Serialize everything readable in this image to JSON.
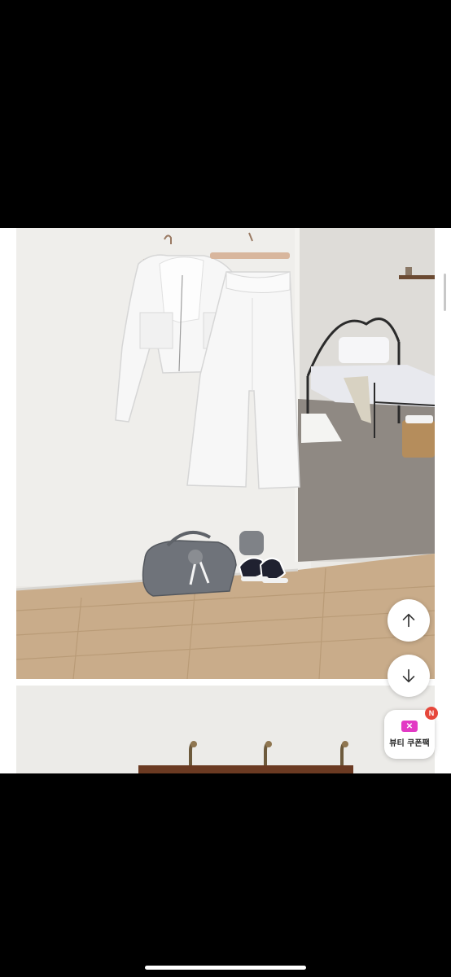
{
  "controls": {
    "scroll_up_icon": "arrow-up-icon",
    "scroll_down_icon": "arrow-down-icon"
  },
  "coupon": {
    "label": "뷰티 쿠폰팩",
    "badge": "N",
    "icon": "coupon-ticket-icon",
    "accent_color": "#e23ac4",
    "badge_color": "#e6473b"
  }
}
